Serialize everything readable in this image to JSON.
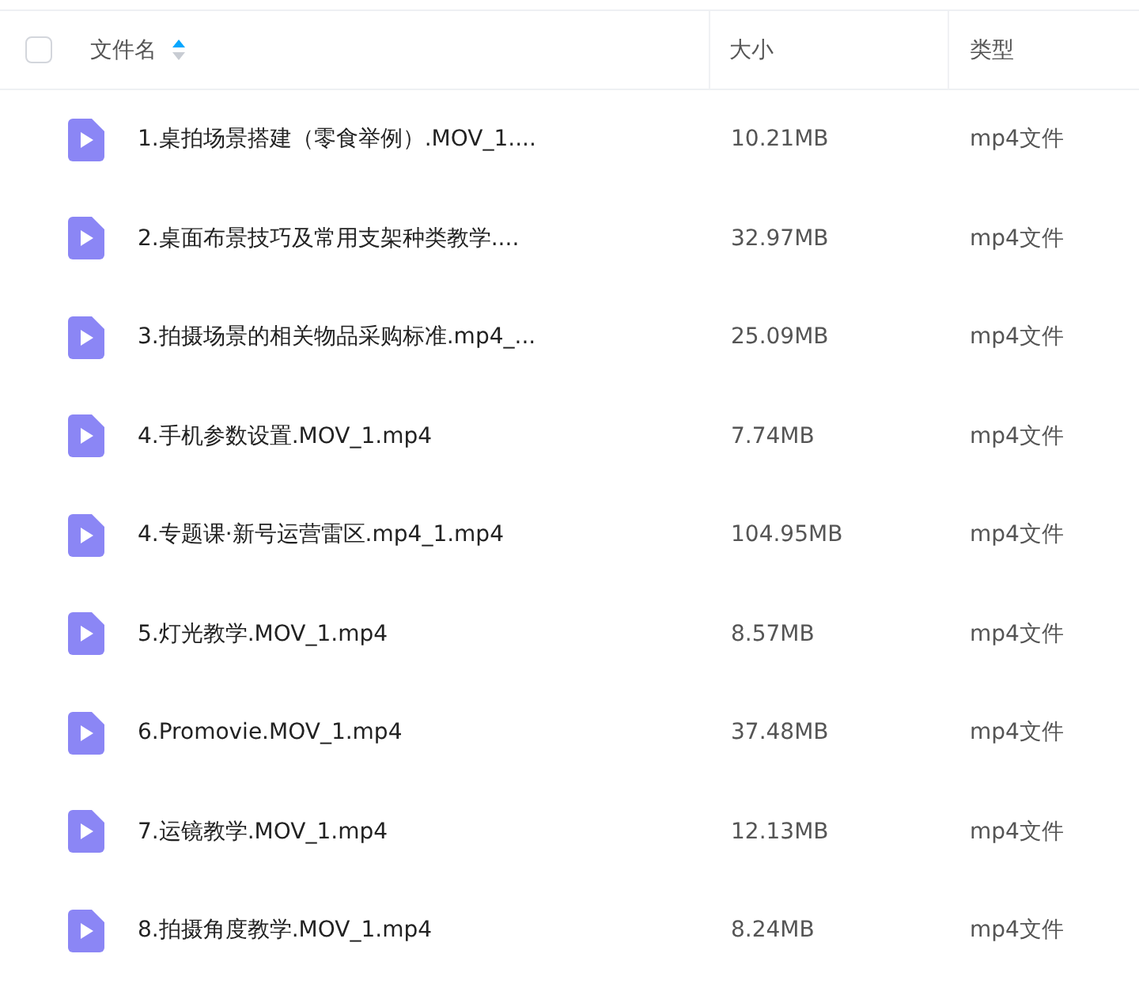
{
  "header": {
    "select_all": {
      "checked": false
    },
    "columns": [
      {
        "label": "文件名",
        "sorted": true
      },
      {
        "label": "大小",
        "sorted": false
      },
      {
        "label": "类型",
        "sorted": false
      }
    ]
  },
  "rows": [
    {
      "name": "1.桌拍场景搭建（零食举例）.MOV_1....",
      "size": "10.21MB",
      "type": "mp4文件"
    },
    {
      "name": "2.桌面布景技巧及常用支架种类教学....",
      "size": "32.97MB",
      "type": "mp4文件"
    },
    {
      "name": "3.拍摄场景的相关物品采购标准.mp4_...",
      "size": "25.09MB",
      "type": "mp4文件"
    },
    {
      "name": "4.手机参数设置.MOV_1.mp4",
      "size": "7.74MB",
      "type": "mp4文件"
    },
    {
      "name": "4.专题课·新号运营雷区.mp4_1.mp4",
      "size": "104.95MB",
      "type": "mp4文件"
    },
    {
      "name": "5.灯光教学.MOV_1.mp4",
      "size": "8.57MB",
      "type": "mp4文件"
    },
    {
      "name": "6.Promovie.MOV_1.mp4",
      "size": "37.48MB",
      "type": "mp4文件"
    },
    {
      "name": "7.运镜教学.MOV_1.mp4",
      "size": "12.13MB",
      "type": "mp4文件"
    },
    {
      "name": "8.拍摄角度教学.MOV_1.mp4",
      "size": "8.24MB",
      "type": "mp4文件"
    }
  ]
}
